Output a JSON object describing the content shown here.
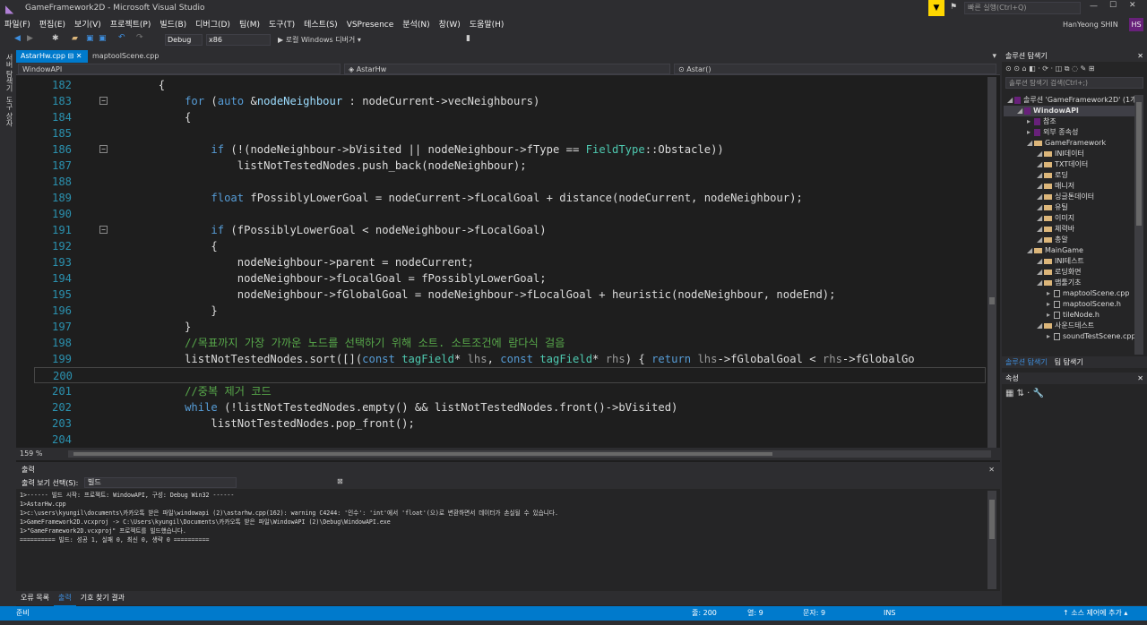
{
  "window": {
    "title": "GameFramework2D - Microsoft Visual Studio",
    "quick_launch": "빠른 실행(Ctrl+Q)",
    "user": "HanYeong SHIN",
    "user_initials": "HS"
  },
  "menu": [
    "파일(F)",
    "편집(E)",
    "보기(V)",
    "프로젝트(P)",
    "빌드(B)",
    "디버그(D)",
    "팀(M)",
    "도구(T)",
    "테스트(S)",
    "VSPresence",
    "분석(N)",
    "창(W)",
    "도움말(H)"
  ],
  "toolbar": {
    "config": "Debug",
    "platform": "x86",
    "run": "▶ 로컬 Windows 디버거 ▾"
  },
  "side_strip": [
    "서버 탐색기",
    "도구 상자"
  ],
  "tabs": [
    {
      "label": "AstarHw.cpp",
      "active": true
    },
    {
      "label": "maptoolScene.cpp",
      "active": false
    }
  ],
  "nav": {
    "project": "WindowAPI",
    "class": "AstarHw",
    "member": "Astar()"
  },
  "code_lines": [
    {
      "n": "182",
      "html": "        {"
    },
    {
      "n": "183",
      "html": "            <span class='kw'>for</span> (<span class='kw'>auto</span> &amp;<span style='color:#9cdcfe'>nodeNeighbour</span> : nodeCurrent-&gt;vecNeighbours)",
      "fold": true
    },
    {
      "n": "184",
      "html": "            {"
    },
    {
      "n": "185",
      "html": ""
    },
    {
      "n": "186",
      "html": "                <span class='kw'>if</span> (!(nodeNeighbour-&gt;bVisited || nodeNeighbour-&gt;fType == <span class='ty'>FieldType</span>::Obstacle))",
      "fold": true
    },
    {
      "n": "187",
      "html": "                    listNotTestedNodes.push_back(nodeNeighbour);"
    },
    {
      "n": "188",
      "html": ""
    },
    {
      "n": "189",
      "html": "                <span class='kw'>float</span> fPossiblyLowerGoal = nodeCurrent-&gt;fLocalGoal + distance(nodeCurrent, nodeNeighbour);"
    },
    {
      "n": "190",
      "html": ""
    },
    {
      "n": "191",
      "html": "                <span class='kw'>if</span> (fPossiblyLowerGoal &lt; nodeNeighbour-&gt;fLocalGoal)",
      "fold": true
    },
    {
      "n": "192",
      "html": "                {"
    },
    {
      "n": "193",
      "html": "                    nodeNeighbour-&gt;parent = nodeCurrent;"
    },
    {
      "n": "194",
      "html": "                    nodeNeighbour-&gt;fLocalGoal = fPossiblyLowerGoal;"
    },
    {
      "n": "195",
      "html": "                    nodeNeighbour-&gt;fGlobalGoal = nodeNeighbour-&gt;fLocalGoal + heuristic(nodeNeighbour, nodeEnd);"
    },
    {
      "n": "196",
      "html": "                }"
    },
    {
      "n": "197",
      "html": "            }"
    },
    {
      "n": "198",
      "html": "            <span class='cm'>//목표까지 가장 가까운 노드를 선택하기 위해 소트. 소트조건에 람다식 걸음</span>"
    },
    {
      "n": "199",
      "html": "            listNotTestedNodes.sort([](<span class='kw'>const</span> <span class='ty'>tagField</span>* <span class='pa'>lhs</span>, <span class='kw'>const</span> <span class='ty'>tagField</span>* <span class='pa'>rhs</span>) { <span class='kw'>return</span> <span class='pa'>lhs</span>-&gt;fGlobalGoal &lt; <span class='pa'>rhs</span>-&gt;fGlobalGo"
    },
    {
      "n": "200",
      "html": "",
      "current": true
    },
    {
      "n": "201",
      "html": "            <span class='cm'>//중복 제거 코드</span>"
    },
    {
      "n": "202",
      "html": "            <span class='kw'>while</span> (!listNotTestedNodes.empty() &amp;&amp; listNotTestedNodes.front()-&gt;bVisited)"
    },
    {
      "n": "203",
      "html": "                listNotTestedNodes.pop_front();"
    },
    {
      "n": "204",
      "html": ""
    }
  ],
  "zoom": "159 %",
  "output": {
    "header": "출력",
    "select_label": "출력 보기 선택(S):",
    "select_value": "빌드",
    "lines": [
      "1>------ 빌드 시작: 프로젝트: WindowAPI, 구성: Debug Win32 ------",
      "1>AstarHw.cpp",
      "1>c:\\users\\kyungil\\documents\\카카오톡 받은 파일\\windowapi (2)\\astarhw.cpp(162): warning C4244: '인수': 'int'에서 'float'(으)로 변환하면서 데이터가 손실될 수 있습니다.",
      "1>GameFramework2D.vcxproj -> C:\\Users\\kyungil\\Documents\\카카오톡 받은 파일\\WindowAPI (2)\\Debug\\WindowAPI.exe",
      "1>\"GameFramework2D.vcxproj\" 프로젝트를 빌드했습니다.",
      "========== 빌드: 성공 1, 실패 0, 최신 0, 생략 0 =========="
    ]
  },
  "bottom_tabs": [
    "오류 목록",
    "출력",
    "기호 찾기 결과"
  ],
  "status": {
    "ready": "준비",
    "line": "줄: 200",
    "col": "열: 9",
    "char": "문자: 9",
    "ins": "INS",
    "source_control": "↑ 소스 제어에 추가 ▴"
  },
  "solution_explorer": {
    "title": "솔루션 탐색기",
    "search": "솔루션 탐색기 검색(Ctrl+;)",
    "items": [
      {
        "label": "솔루션 'GameFramework2D' (1개",
        "indent": 0,
        "kind": "sol"
      },
      {
        "label": "WindowAPI",
        "indent": 1,
        "kind": "proj"
      },
      {
        "label": "참조",
        "indent": 2,
        "kind": "ref"
      },
      {
        "label": "외부 종속성",
        "indent": 2,
        "kind": "ref"
      },
      {
        "label": "GameFramework",
        "indent": 2,
        "kind": "folder"
      },
      {
        "label": "INI데이터",
        "indent": 3,
        "kind": "folder"
      },
      {
        "label": "TXT데이터",
        "indent": 3,
        "kind": "folder"
      },
      {
        "label": "로딩",
        "indent": 3,
        "kind": "folder"
      },
      {
        "label": "매니저",
        "indent": 3,
        "kind": "folder"
      },
      {
        "label": "싱글톤데이터",
        "indent": 3,
        "kind": "folder"
      },
      {
        "label": "유틸",
        "indent": 3,
        "kind": "folder"
      },
      {
        "label": "이미지",
        "indent": 3,
        "kind": "folder"
      },
      {
        "label": "체력바",
        "indent": 3,
        "kind": "folder"
      },
      {
        "label": "총알",
        "indent": 3,
        "kind": "folder"
      },
      {
        "label": "MainGame",
        "indent": 2,
        "kind": "folder"
      },
      {
        "label": "INI테스트",
        "indent": 3,
        "kind": "folder"
      },
      {
        "label": "로딩화면",
        "indent": 3,
        "kind": "folder"
      },
      {
        "label": "맵툴기초",
        "indent": 3,
        "kind": "folder"
      },
      {
        "label": "maptoolScene.cpp",
        "indent": 4,
        "kind": "file"
      },
      {
        "label": "maptoolScene.h",
        "indent": 4,
        "kind": "file"
      },
      {
        "label": "tileNode.h",
        "indent": 4,
        "kind": "file"
      },
      {
        "label": "사운드테스트",
        "indent": 3,
        "kind": "folder"
      },
      {
        "label": "soundTestScene.cpp",
        "indent": 4,
        "kind": "file"
      }
    ],
    "tabs": [
      "솔루션 탐색기",
      "팀 탐색기"
    ]
  },
  "properties": {
    "title": "속성"
  }
}
